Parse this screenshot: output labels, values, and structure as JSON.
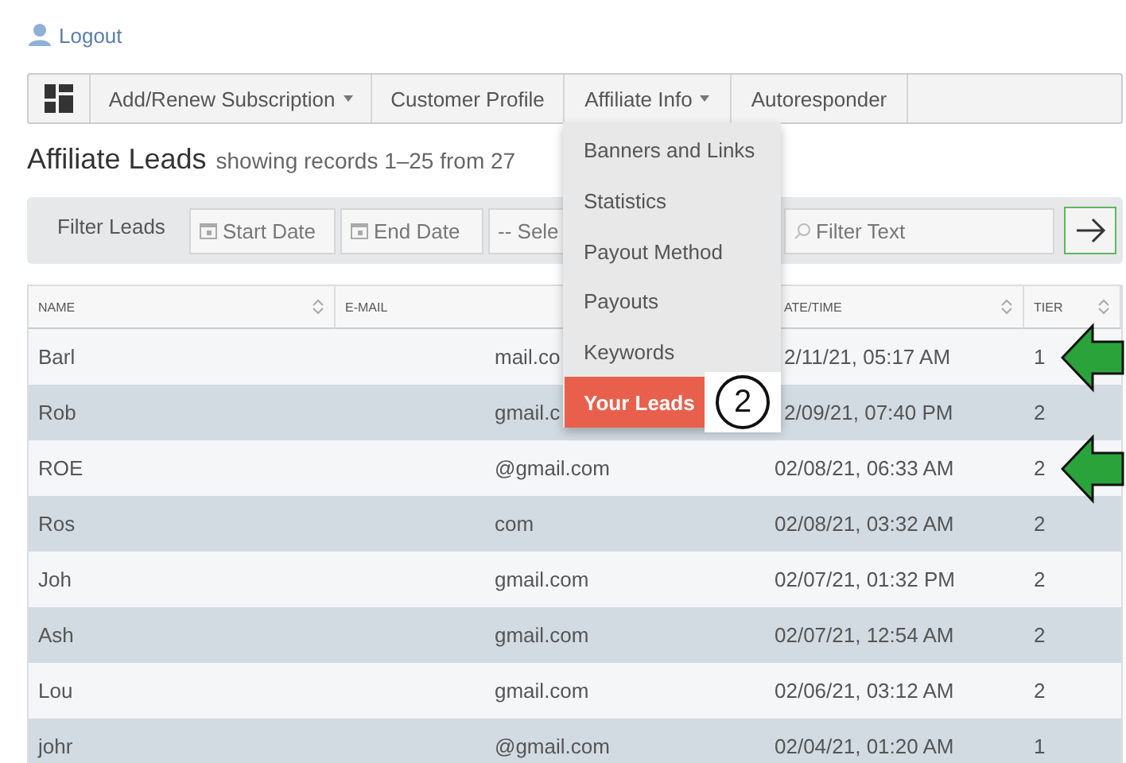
{
  "top_link": {
    "label": "Logout"
  },
  "nav": [
    {
      "label": "Add/Renew Subscription",
      "caret": true
    },
    {
      "label": "Customer Profile",
      "caret": false
    },
    {
      "label": "Affiliate Info",
      "caret": true
    },
    {
      "label": "Autoresponder",
      "caret": false
    }
  ],
  "dropdown": {
    "items": [
      {
        "label": "Banners and Links",
        "selected": false
      },
      {
        "label": "Statistics",
        "selected": false
      },
      {
        "label": "Payout Method",
        "selected": false
      },
      {
        "label": "Payouts",
        "selected": false
      },
      {
        "label": "Keywords",
        "selected": false
      },
      {
        "label": "Your Leads",
        "selected": true
      }
    ],
    "step_badge": "2"
  },
  "heading": {
    "title": "Affiliate Leads",
    "subtitle": "showing records 1–25 from 27"
  },
  "filter": {
    "label": "Filter Leads",
    "start_placeholder": "Start Date",
    "end_placeholder": "End Date",
    "select": "-- Sele",
    "text_placeholder": "Filter Text"
  },
  "table": {
    "columns": [
      "NAME",
      "E-MAIL",
      "ATE/TIME",
      "TIER"
    ],
    "rows": [
      {
        "name": "Barl",
        "email": "mail.co",
        "date": "2/11/21, 05:17 AM",
        "tier": "1",
        "arrow": true
      },
      {
        "name": "Rob",
        "email": "gmail.c",
        "date": "2/09/21, 07:40 PM",
        "tier": "2",
        "arrow": false
      },
      {
        "name": "ROE",
        "email": "@gmail.com",
        "date": "02/08/21, 06:33 AM",
        "tier": "2",
        "arrow": true
      },
      {
        "name": "Ros",
        "email": "com",
        "date": "02/08/21, 03:32 AM",
        "tier": "2",
        "arrow": false
      },
      {
        "name": "Joh",
        "email": "gmail.com",
        "date": "02/07/21, 01:32 PM",
        "tier": "2",
        "arrow": false
      },
      {
        "name": "Ash",
        "email": "gmail.com",
        "date": "02/07/21, 12:54 AM",
        "tier": "2",
        "arrow": false
      },
      {
        "name": "Lou",
        "email": "gmail.com",
        "date": "02/06/21, 03:12 AM",
        "tier": "2",
        "arrow": false
      },
      {
        "name": "johr",
        "email": "@gmail.com",
        "date": "02/04/21, 01:20 AM",
        "tier": "1",
        "arrow": false
      }
    ]
  }
}
